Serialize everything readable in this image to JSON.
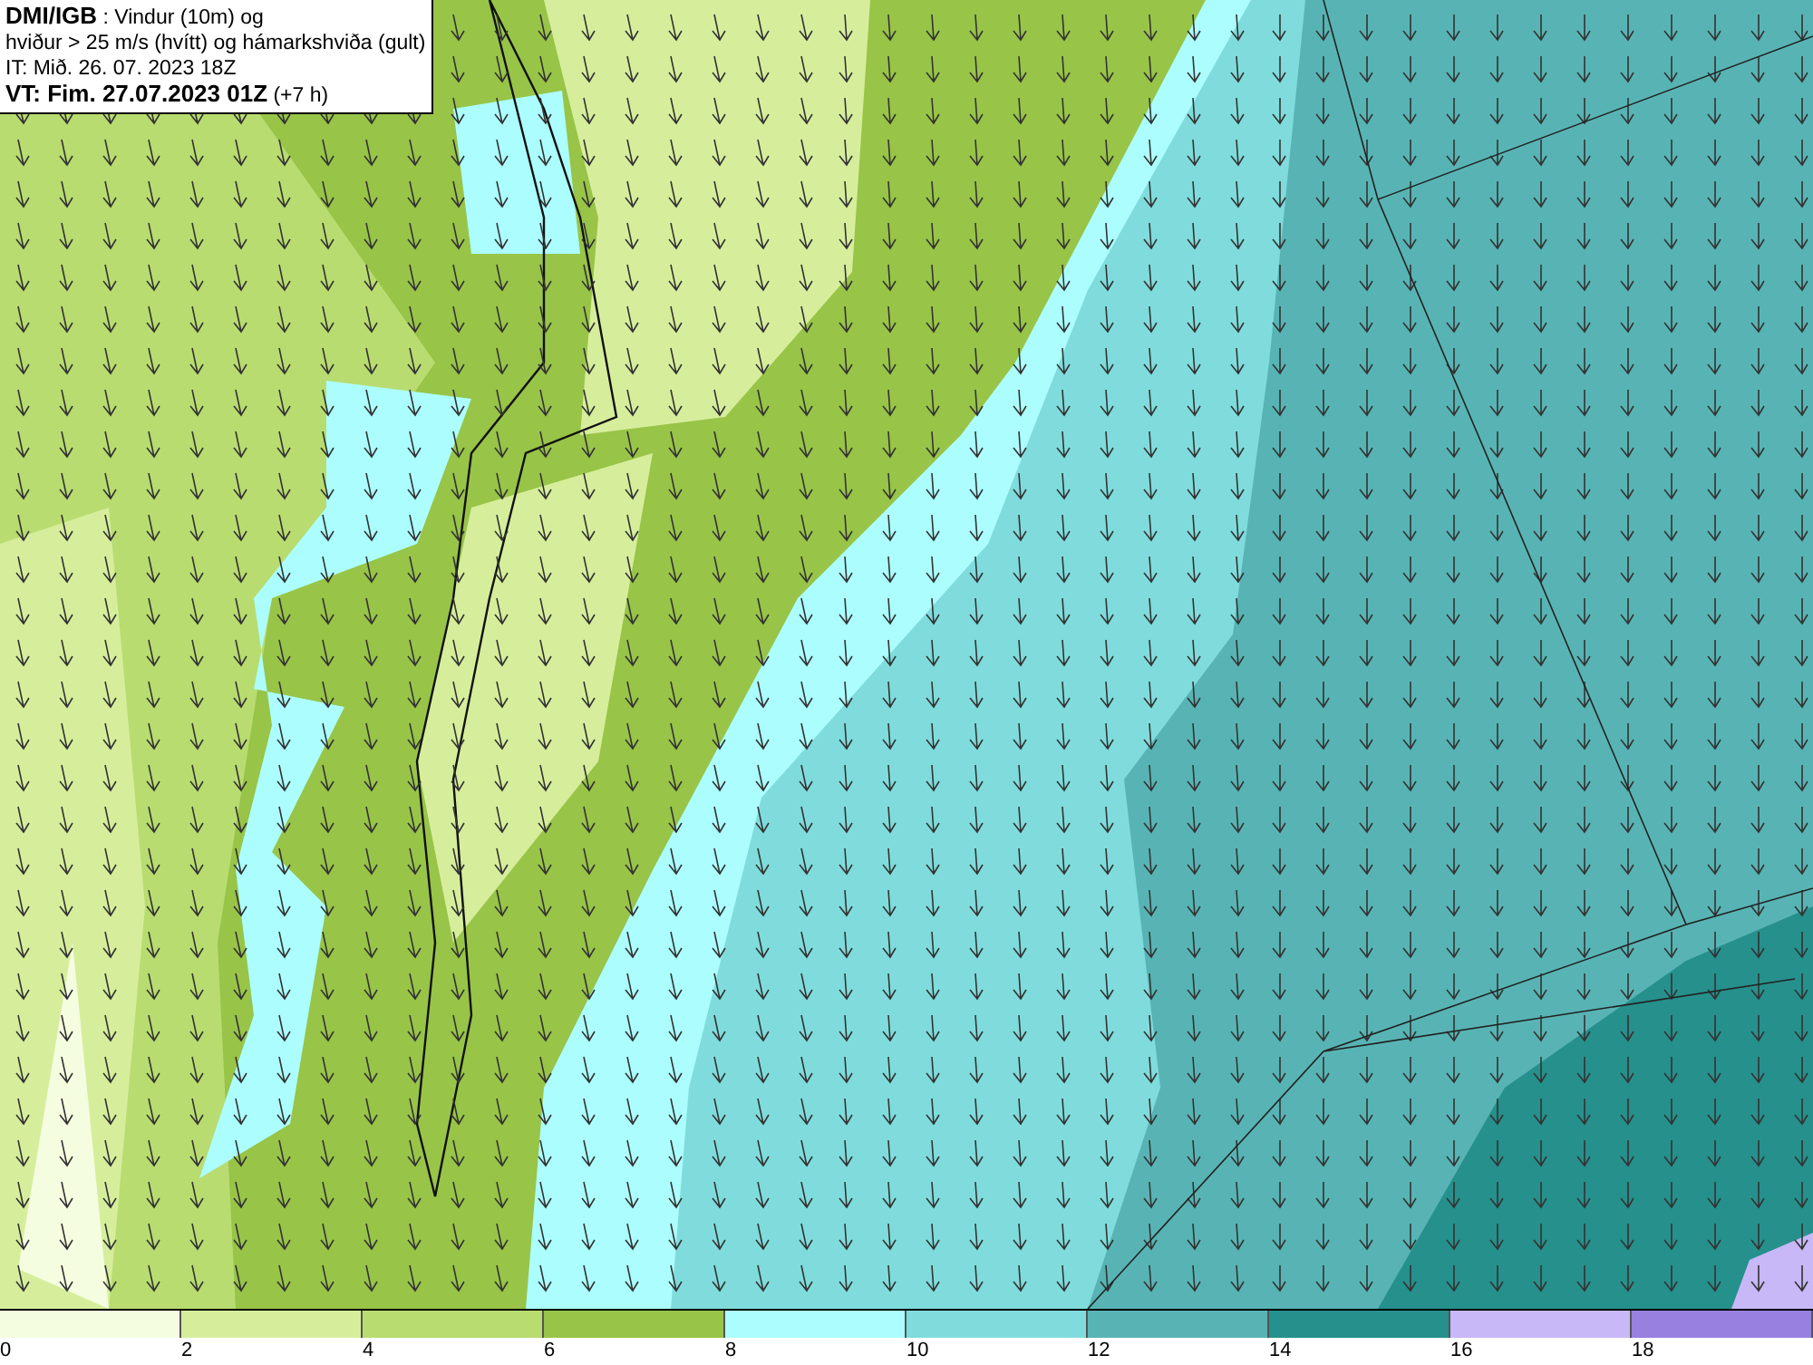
{
  "title_box": {
    "lines": [
      "**DMI/IGB** : Vindur (10m) og",
      "hviður > 25 m/s (hvítt) og hámarkshviða (gult)",
      "IT: Mið. 26. 07. 2023 18Z",
      "**VT: Fim. 27.07.2023 01Z** (+7 h)"
    ]
  },
  "legend": {
    "bins": [
      {
        "color": "#f5fde0",
        "label": "0"
      },
      {
        "color": "#d6ee9c",
        "label": "2"
      },
      {
        "color": "#b8dc70",
        "label": "4"
      },
      {
        "color": "#98c448",
        "label": "6"
      },
      {
        "color": "#acfefe",
        "label": "8"
      },
      {
        "color": "#80dcdc",
        "label": "10"
      },
      {
        "color": "#58b4b4",
        "label": "12"
      },
      {
        "color": "#26908c",
        "label": "14"
      },
      {
        "color": "#c8b8f8",
        "label": "16"
      },
      {
        "color": "#9880e0",
        "label": "18"
      }
    ]
  }
}
